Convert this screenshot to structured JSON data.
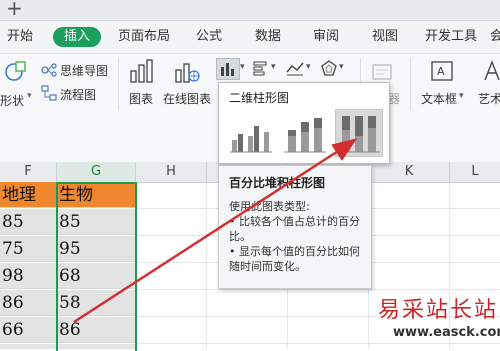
{
  "title_strip": {
    "add_tab_glyph": "+"
  },
  "menu": {
    "tabs": [
      {
        "label": "开始",
        "active": false
      },
      {
        "label": "插入",
        "active": true
      },
      {
        "label": "页面布局",
        "active": false
      },
      {
        "label": "公式",
        "active": false
      },
      {
        "label": "数据",
        "active": false
      },
      {
        "label": "审阅",
        "active": false
      },
      {
        "label": "视图",
        "active": false
      },
      {
        "label": "开发工具",
        "active": false
      },
      {
        "label": "会",
        "active": false
      }
    ]
  },
  "ribbon": {
    "shapes_label": "形状",
    "mindmap_label": "思维导图",
    "flowchart_label": "流程图",
    "chart_label": "图表",
    "online_chart_label": "在线图表",
    "textbox_label": "文本框",
    "art_label": "艺术",
    "partial_label": "器"
  },
  "sheet": {
    "columns": [
      "F",
      "G",
      "H",
      "I",
      "J",
      "K",
      "L"
    ],
    "selected_column": "G",
    "headers": {
      "F": "地理",
      "G": "生物"
    },
    "rows": [
      {
        "F": "85",
        "G": "85"
      },
      {
        "F": "75",
        "G": "95"
      },
      {
        "F": "98",
        "G": "68"
      },
      {
        "F": "86",
        "G": "58"
      },
      {
        "F": "66",
        "G": "86"
      }
    ],
    "header_fill": "#f0872e",
    "data_fill": "#e3e3e3",
    "selection_border": "#1e9a4a"
  },
  "chart_dropdown": {
    "title": "二维柱形图",
    "options": [
      {
        "name": "簇状柱形图",
        "selected": false
      },
      {
        "name": "堆积柱形图",
        "selected": false
      },
      {
        "name": "百分比堆积柱形图",
        "selected": true
      }
    ]
  },
  "tooltip": {
    "title": "百分比堆积柱形图",
    "body": "使用此图表类型:\n• 比较各个值占总计的百分比。\n• 显示每个值的百分比如何随时间而变化。"
  },
  "annotation": {
    "arrow_color": "#d32f2f"
  },
  "watermark": {
    "text": "易采站长站",
    "url": "www.easck.com"
  }
}
